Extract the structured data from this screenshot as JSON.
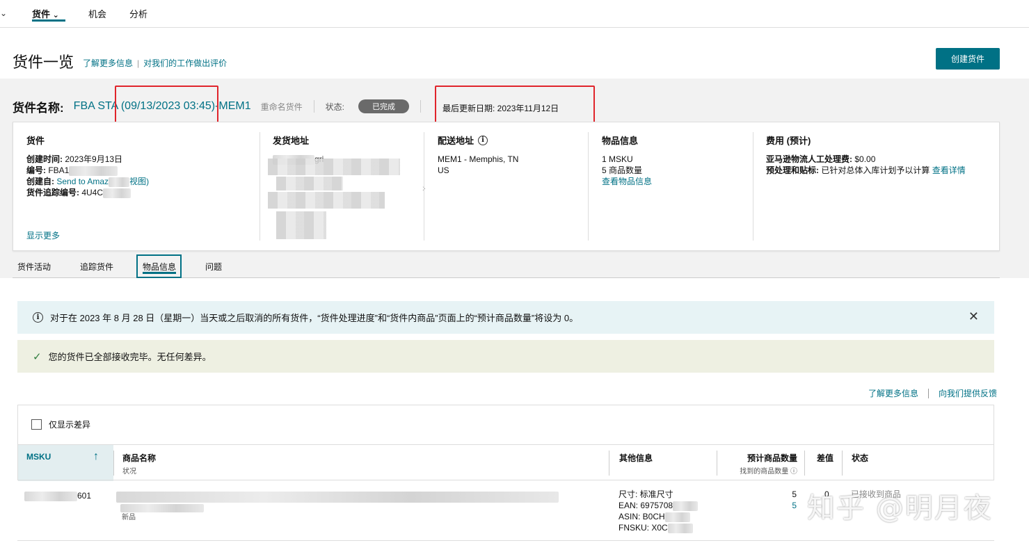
{
  "topnav": {
    "items": [
      {
        "label": "货件"
      },
      {
        "label": "机会"
      },
      {
        "label": "分析"
      }
    ]
  },
  "header": {
    "title": "货件一览",
    "learn_more": "了解更多信息",
    "feedback": "对我们的工作做出评价",
    "sep": "|",
    "create_button": "创建货件"
  },
  "shipment": {
    "name_label": "货件名称:",
    "name_value": "FBA STA (09/13/2023 03:45)-MEM1",
    "rename": "重命名货件",
    "status_label": "状态:",
    "status_value": "已完成",
    "updated": "最后更新日期: 2023年11月12日"
  },
  "info": {
    "shipment": {
      "title": "货件",
      "created_label": "创建时间:",
      "created_value": "2023年9月13日",
      "number_label": "编号:",
      "number_value": "FBA1",
      "created_from_label": "创建自:",
      "created_from_value": "Send to Amaz",
      "created_from_tail": "视图)",
      "tracking_label": "货件追踪编号:",
      "tracking_value": "4U4C",
      "show_more": "显示更多"
    },
    "from": {
      "title": "发货地址",
      "partial": "gri"
    },
    "to": {
      "title": "配送地址",
      "line1": "MEM1 - Memphis, TN",
      "line2": "US"
    },
    "items": {
      "title": "物品信息",
      "msku": "1 MSKU",
      "units": "5 商品数量",
      "view": "查看物品信息"
    },
    "fees": {
      "title": "费用 (预计)",
      "labor_label": "亚马逊物流人工处理费:",
      "labor_value": "$0.00",
      "prep_label": "预处理和贴标:",
      "prep_value": "已针对总体入库计划予以计算",
      "prep_link": "查看详情"
    }
  },
  "tabs": [
    {
      "label": "货件活动"
    },
    {
      "label": "追踪货件"
    },
    {
      "label": "物品信息"
    },
    {
      "label": "问题"
    }
  ],
  "alerts": {
    "info": "对于在 2023 年 8 月 28 日（星期一）当天或之后取消的所有货件，“货件处理进度”和“货件内商品”页面上的“预计商品数量”将设为 0。",
    "success": "您的货件已全部接收完毕。无任何差异。"
  },
  "links": {
    "learn_more": "了解更多信息",
    "feedback": "向我们提供反馈"
  },
  "table": {
    "filter_label": "仅显示差异",
    "headers": {
      "msku": "MSKU",
      "name": "商品名称",
      "name_sub": "状况",
      "other": "其他信息",
      "expected": "预计商品数量",
      "expected_sub": "找到的商品数量 ⓘ",
      "diff": "差值",
      "status": "状态"
    },
    "row": {
      "msku_tail": "601",
      "condition": "新品",
      "size": "尺寸: 标准尺寸",
      "ean": "EAN: 6975708",
      "asin": "ASIN: B0CH",
      "fnsku": "FNSKU: X0C",
      "expected": "5",
      "found": "5",
      "diff": "0",
      "status": "已接收到商品"
    }
  },
  "watermark": "知乎 @明月夜"
}
